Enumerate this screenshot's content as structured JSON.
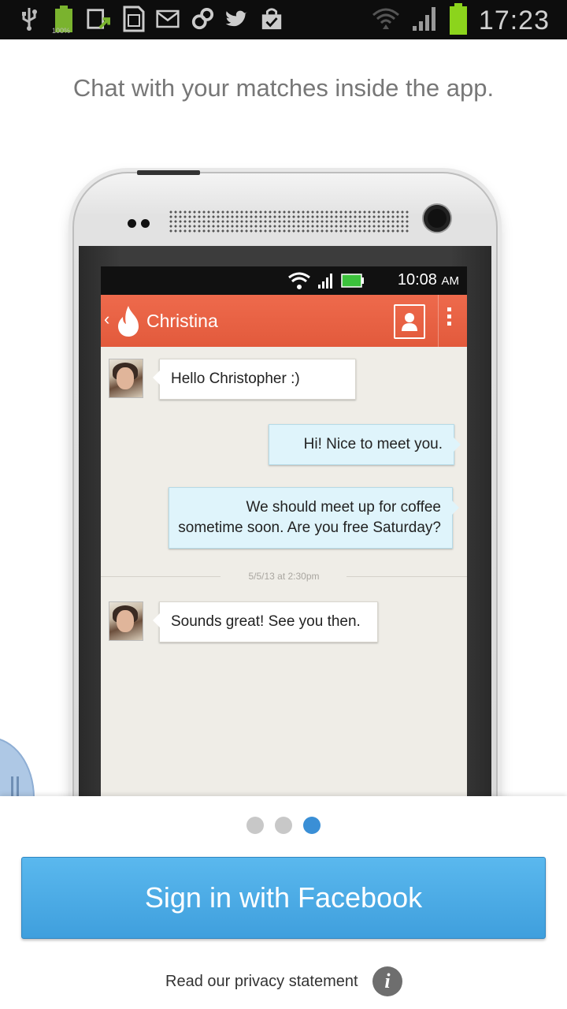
{
  "status_bar": {
    "time": "17:23",
    "battery_label": "100%",
    "icons": [
      "usb-icon",
      "battery-icon",
      "upload-icon",
      "sd-card-icon",
      "gmail-icon",
      "sync-icon",
      "twitter-icon",
      "shopping-bag-icon",
      "wifi-icon",
      "signal-icon",
      "battery-full-icon"
    ]
  },
  "tagline": "Chat with your matches inside the app.",
  "phone_screen": {
    "status_time": "10:08",
    "status_ampm": "AM",
    "contact_name": "Christina",
    "accent_color": "#e8624a",
    "messages": [
      {
        "direction": "in",
        "text": "Hello Christopher :)"
      },
      {
        "direction": "out",
        "text": "Hi! Nice to meet you."
      },
      {
        "direction": "out",
        "text_line1": "We should meet up for coffee",
        "text_line2": "sometime soon. Are you free Saturday?"
      },
      {
        "direction": "in",
        "text": "Sounds great! See you then."
      }
    ],
    "timestamp": "5/5/13 at 2:30pm"
  },
  "pager": {
    "count": 3,
    "active_index": 2
  },
  "facebook_button": {
    "label": "Sign in with Facebook",
    "color": "#4aaae6"
  },
  "privacy": {
    "text": "Read our privacy statement",
    "icon": "info-icon"
  }
}
